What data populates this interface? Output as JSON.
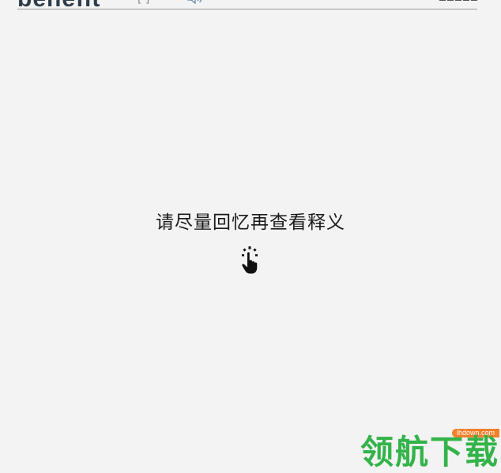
{
  "header": {
    "word": "benefit",
    "phonetic": "[ ]",
    "speaker_icon": "speaker-icon",
    "progress": {
      "total": 5,
      "filled": 1
    }
  },
  "prompt": {
    "text": "请尽量回忆再查看释义",
    "tap_icon": "tap-hand-icon"
  },
  "watermark": {
    "text": "领航下载",
    "site": "lhdown.com"
  },
  "colors": {
    "background": "#f3f3f3",
    "word": "#2e3d4b",
    "divider": "#9a9a9a",
    "watermark_green": "#34b34a",
    "watermark_badge": "#f1802a"
  }
}
